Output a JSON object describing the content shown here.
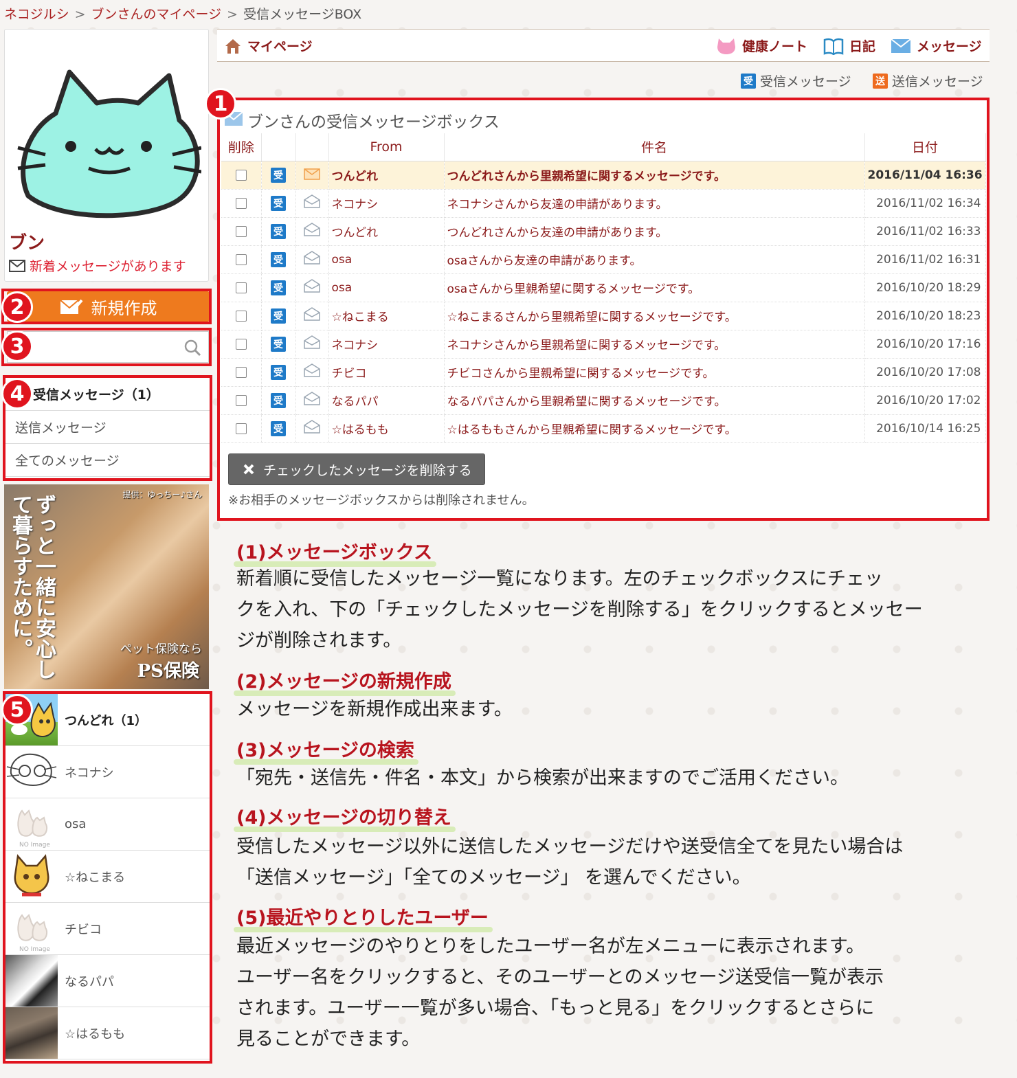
{
  "breadcrumb": [
    "ネコジルシ",
    "ブンさんのマイページ",
    "受信メッセージBOX"
  ],
  "breadcrumb_sep": ">",
  "profile": {
    "name": "ブン",
    "notice": "新着メッセージがあります"
  },
  "badges": [
    "1",
    "2",
    "3",
    "4",
    "5"
  ],
  "compose_label": "新規作成",
  "search": {
    "placeholder": ""
  },
  "menu": [
    "受信メッセージ（1）",
    "送信メッセージ",
    "全てのメッセージ"
  ],
  "ad": {
    "headline": "ずっと一緒に安心して暮らすために。",
    "credit": "提供：ゆっちー♪さん",
    "pet_line": "ペット保険なら",
    "brand": "PS保険"
  },
  "recent_users": [
    "つんどれ（1）",
    "ネコナシ",
    "osa",
    "☆ねこまる",
    "チビコ",
    "なるパパ",
    "☆はるもも"
  ],
  "nav": {
    "mypage": "マイページ",
    "health": "健康ノート",
    "diary": "日記",
    "message": "メッセージ"
  },
  "subtabs": {
    "inbox": "受信メッセージ",
    "outbox": "送信メッセージ",
    "in_chip": "受",
    "out_chip": "送"
  },
  "inbox": {
    "title": "ブンさんの受信メッセージボックス",
    "headers": [
      "削除",
      "",
      "",
      "From",
      "件名",
      "日付"
    ],
    "chip": "受",
    "rows": [
      {
        "from": "つんどれ",
        "subject": "つんどれさんから里親希望に関するメッセージです。",
        "date": "2016/11/04 16:36",
        "unread": true
      },
      {
        "from": "ネコナシ",
        "subject": "ネコナシさんから友達の申請があります。",
        "date": "2016/11/02 16:34",
        "unread": false
      },
      {
        "from": "つんどれ",
        "subject": "つんどれさんから友達の申請があります。",
        "date": "2016/11/02 16:33",
        "unread": false
      },
      {
        "from": "osa",
        "subject": "osaさんから友達の申請があります。",
        "date": "2016/11/02 16:31",
        "unread": false
      },
      {
        "from": "osa",
        "subject": "osaさんから里親希望に関するメッセージです。",
        "date": "2016/10/20 18:29",
        "unread": false
      },
      {
        "from": "☆ねこまる",
        "subject": "☆ねこまるさんから里親希望に関するメッセージです。",
        "date": "2016/10/20 18:23",
        "unread": false
      },
      {
        "from": "ネコナシ",
        "subject": "ネコナシさんから里親希望に関するメッセージです。",
        "date": "2016/10/20 17:16",
        "unread": false
      },
      {
        "from": "チビコ",
        "subject": "チビコさんから里親希望に関するメッセージです。",
        "date": "2016/10/20 17:08",
        "unread": false
      },
      {
        "from": "なるパパ",
        "subject": "なるパパさんから里親希望に関するメッセージです。",
        "date": "2016/10/20 17:02",
        "unread": false
      },
      {
        "from": "☆はるもも",
        "subject": "☆はるももさんから里親希望に関するメッセージです。",
        "date": "2016/10/14 16:25",
        "unread": false
      }
    ],
    "delete_label": "チェックしたメッセージを削除する",
    "note": "※お相手のメッセージボックスからは削除されません。"
  },
  "sections": [
    {
      "title": "(1)メッセージボックス",
      "lines": [
        "新着順に受信したメッセージ一覧になります。左のチェックボックスにチェッ",
        "クを入れ、下の「チェックしたメッセージを削除する」をクリックするとメッセー",
        "ジが削除されます。"
      ]
    },
    {
      "title": "(2)メッセージの新規作成",
      "lines": [
        "メッセージを新規作成出来ます。"
      ]
    },
    {
      "title": "(3)メッセージの検索",
      "lines": [
        "「宛先・送信先・件名・本文」から検索が出来ますのでご活用ください。"
      ]
    },
    {
      "title": "(4)メッセージの切り替え",
      "lines": [
        "受信したメッセージ以外に送信したメッセージだけや送受信全てを見たい場合は",
        "「送信メッセージ」「全てのメッセージ」 を選んでください。"
      ]
    },
    {
      "title": "(5)最近やりとりしたユーザー",
      "lines": [
        "最近メッセージのやりとりをしたユーザー名が左メニューに表示されます。",
        "ユーザー名をクリックすると、そのユーザーとのメッセージ送受信一覧が表示",
        "されます。ユーザー一覧が多い場合、「もっと見る」をクリックするとさらに",
        "見ることができます。"
      ]
    }
  ],
  "colors": {
    "accent_red": "#e0141e",
    "title_red": "#8b1a1a",
    "orange": "#ee7a1e",
    "inbox_blue": "#1e7ac8"
  }
}
